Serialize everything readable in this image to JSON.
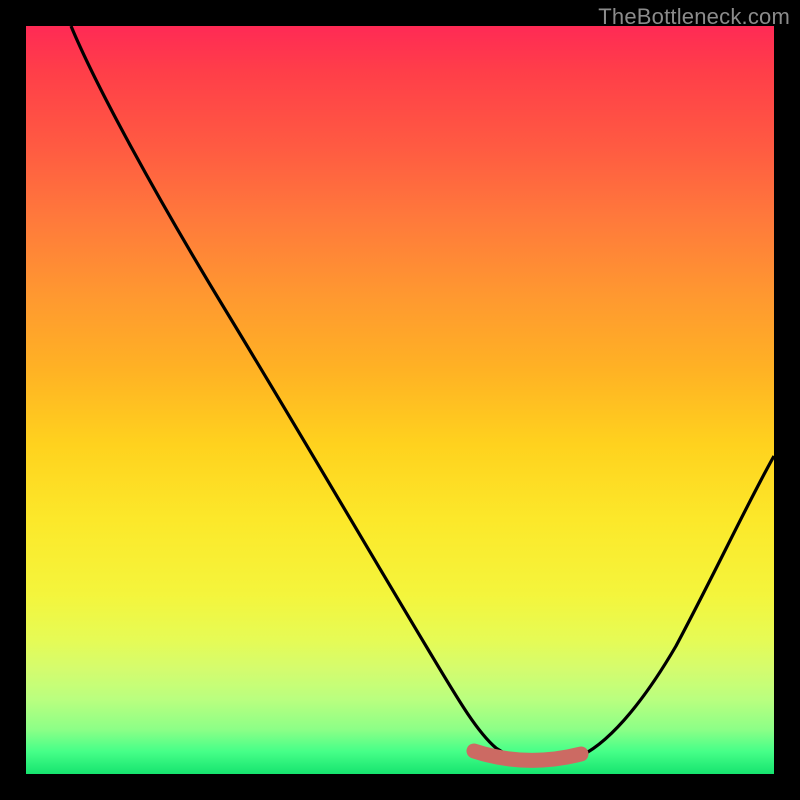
{
  "watermark": {
    "text": "TheBottleneck.com"
  },
  "colors": {
    "frame": "#000000",
    "curve": "#000000",
    "valley_stroke": "#cc6a63",
    "valley_fill": "#cc6a63"
  },
  "chart_data": {
    "type": "line",
    "title": "",
    "xlabel": "",
    "ylabel": "",
    "xlim": [
      0,
      100
    ],
    "ylim": [
      0,
      100
    ],
    "notes": "Bottleneck-style curve on a vertical red-to-green gradient. No axis ticks or numeric labels visible. Values estimated from pixel geometry (0-100 on each axis).",
    "series": [
      {
        "name": "bottleneck-curve",
        "x": [
          6,
          10,
          20,
          30,
          40,
          50,
          56,
          60,
          64,
          70,
          74,
          80,
          86,
          92,
          100
        ],
        "y": [
          100,
          93,
          77,
          61,
          44,
          28,
          18,
          11,
          6,
          2,
          2,
          4,
          13,
          25,
          43
        ]
      }
    ],
    "highlight": {
      "name": "optimal-range",
      "x": [
        60,
        74
      ],
      "y": [
        3,
        3
      ]
    }
  }
}
